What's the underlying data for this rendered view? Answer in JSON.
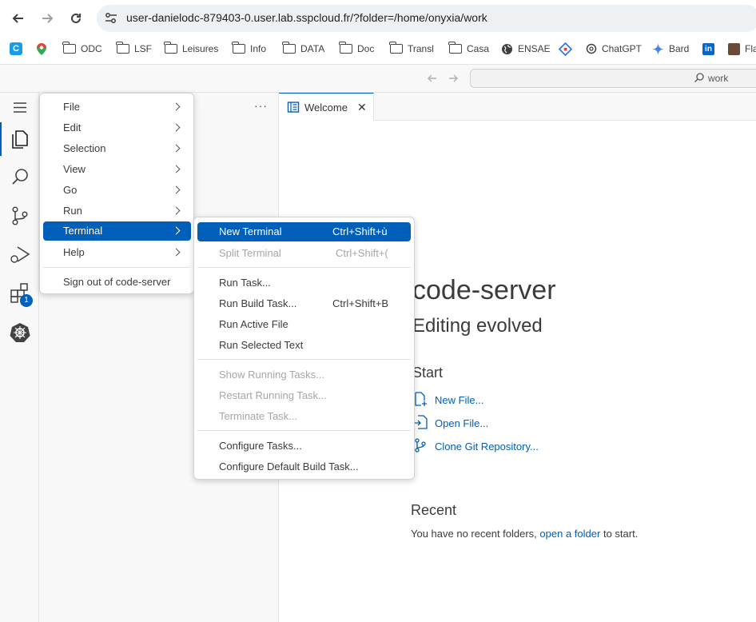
{
  "browser": {
    "url": "user-danielodc-879403-0.user.lab.sspcloud.fr/?folder=/home/onyxia/work",
    "bookmarks": [
      "ODC",
      "LSF",
      "Leisures",
      "Info",
      "DATA",
      "Doc",
      "Transl",
      "Casa",
      "ENSAE",
      "ChatGPT",
      "Bard",
      "Fla"
    ]
  },
  "titlebar": {
    "search_text": "work"
  },
  "editor": {
    "tab_label": "Welcome",
    "title": "code-server",
    "subtitle": "Editing evolved",
    "start_heading": "Start",
    "start_links": [
      "New File...",
      "Open File...",
      "Clone Git Repository..."
    ],
    "recent_heading": "Recent",
    "recent_text_before": "You have no recent folders,",
    "recent_link": "open a folder",
    "recent_text_after": "to start."
  },
  "activity": {
    "extensions_badge": "1"
  },
  "main_menu": {
    "items": [
      "File",
      "Edit",
      "Selection",
      "View",
      "Go",
      "Run",
      "Terminal",
      "Help"
    ],
    "sign_out": "Sign out of code-server",
    "selected": "Terminal"
  },
  "terminal_menu": {
    "new_terminal": "New Terminal",
    "new_terminal_kb": "Ctrl+Shift+ù",
    "split_terminal": "Split Terminal",
    "split_terminal_kb": "Ctrl+Shift+(",
    "run_task": "Run Task...",
    "run_build_task": "Run Build Task...",
    "run_build_task_kb": "Ctrl+Shift+B",
    "run_active_file": "Run Active File",
    "run_selected_text": "Run Selected Text",
    "show_running": "Show Running Tasks...",
    "restart_running": "Restart Running Task...",
    "terminate": "Terminate Task...",
    "configure_tasks": "Configure Tasks...",
    "configure_default": "Configure Default Build Task..."
  },
  "colors": {
    "accent": "#005fb8",
    "badge": "#005fb8"
  }
}
